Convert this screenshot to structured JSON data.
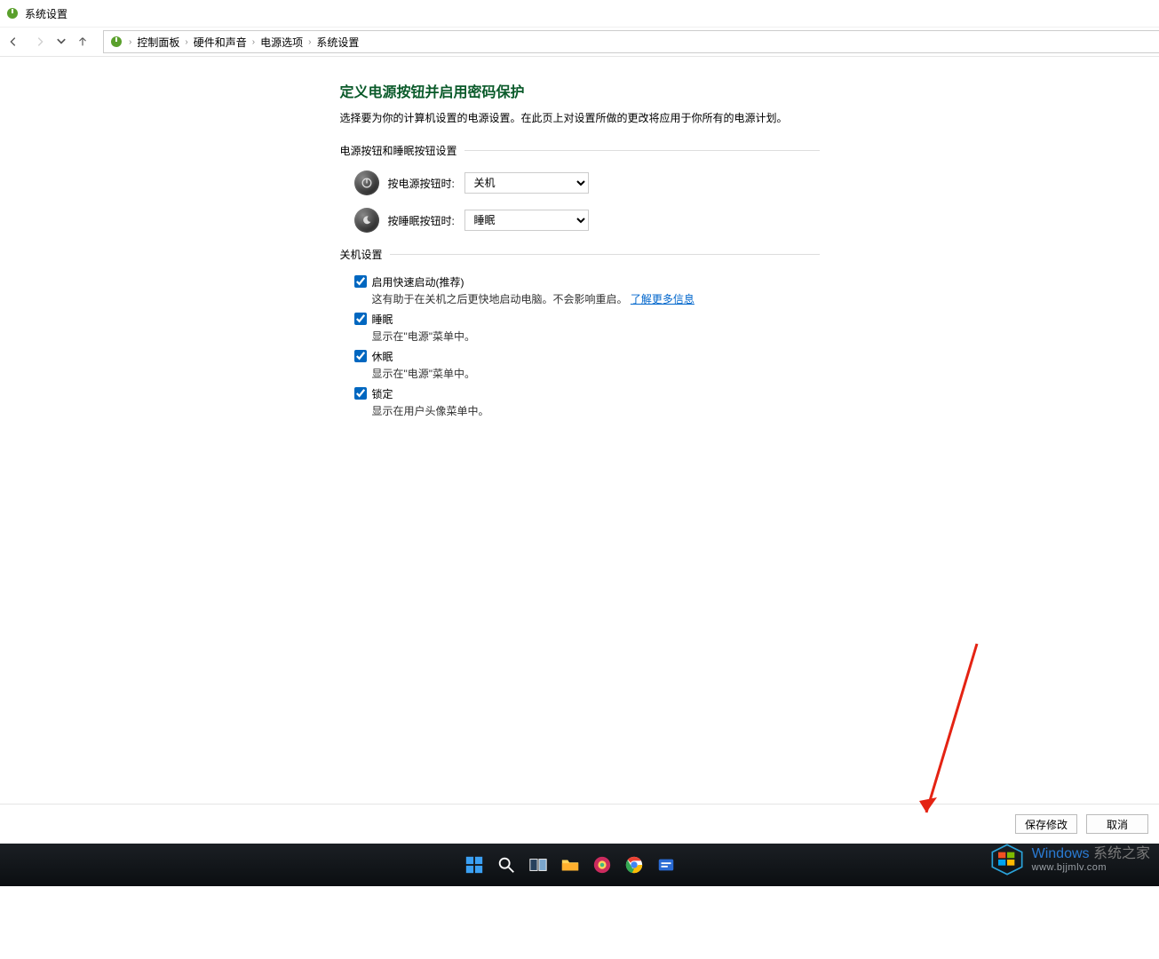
{
  "window": {
    "title": "系统设置"
  },
  "breadcrumb": {
    "items": [
      "控制面板",
      "硬件和声音",
      "电源选项",
      "系统设置"
    ]
  },
  "page": {
    "heading": "定义电源按钮并启用密码保护",
    "description": "选择要为你的计算机设置的电源设置。在此页上对设置所做的更改将应用于你所有的电源计划。"
  },
  "section_power_buttons": {
    "legend": "电源按钮和睡眠按钮设置",
    "power_label": "按电源按钮时:",
    "power_value": "关机",
    "sleep_label": "按睡眠按钮时:",
    "sleep_value": "睡眠"
  },
  "section_shutdown": {
    "legend": "关机设置",
    "items": [
      {
        "title": "启用快速启动(推荐)",
        "desc_prefix": "这有助于在关机之后更快地启动电脑。不会影响重启。",
        "link": "了解更多信息",
        "checked": true
      },
      {
        "title": "睡眠",
        "desc_prefix": "显示在\"电源\"菜单中。",
        "link": "",
        "checked": true
      },
      {
        "title": "休眠",
        "desc_prefix": "显示在\"电源\"菜单中。",
        "link": "",
        "checked": true
      },
      {
        "title": "锁定",
        "desc_prefix": "显示在用户头像菜单中。",
        "link": "",
        "checked": true
      }
    ]
  },
  "buttons": {
    "save": "保存修改",
    "cancel": "取消"
  },
  "watermark": {
    "brand_en": "Windows",
    "brand_cn": "系统之家",
    "url": "www.bjjmlv.com"
  }
}
